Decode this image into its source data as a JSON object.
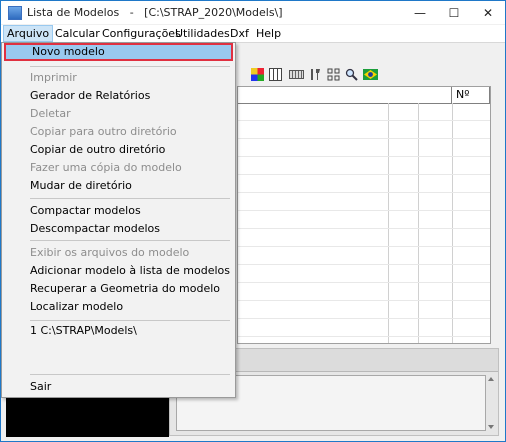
{
  "window": {
    "title": "Lista de Modelos   -   [C:\\STRAP_2020\\Models\\]",
    "minimize_glyph": "—",
    "maximize_glyph": "☐",
    "close_glyph": "✕"
  },
  "menubar": {
    "items": [
      {
        "label": "Arquivo"
      },
      {
        "label": "Calcular"
      },
      {
        "label": "Configurações"
      },
      {
        "label": "Utilidades"
      },
      {
        "label": "Dxf"
      },
      {
        "label": "Help"
      }
    ]
  },
  "arquivo_menu": {
    "items": [
      {
        "label": "Novo modelo",
        "enabled": true
      },
      {
        "label": "Imprimir",
        "enabled": false
      },
      {
        "label": "Gerador de Relatórios",
        "enabled": true
      },
      {
        "label": "Deletar",
        "enabled": false
      },
      {
        "label": "Copiar para outro diretório",
        "enabled": false
      },
      {
        "label": "Copiar de outro diretório",
        "enabled": true
      },
      {
        "label": "Fazer uma cópia do modelo",
        "enabled": false
      },
      {
        "label": "Mudar de diretório",
        "enabled": true
      },
      {
        "label": "Compactar modelos",
        "enabled": true
      },
      {
        "label": "Descompactar modelos",
        "enabled": true
      },
      {
        "label": "Exibir os arquivos do modelo",
        "enabled": false
      },
      {
        "label": "Adicionar modelo à lista de modelos",
        "enabled": true
      },
      {
        "label": "Recuperar a Geometria do modelo",
        "enabled": true
      },
      {
        "label": "Localizar modelo",
        "enabled": true
      },
      {
        "label": "1 C:\\STRAP\\Models\\",
        "enabled": true
      },
      {
        "label": "Sair",
        "enabled": true
      }
    ]
  },
  "table": {
    "number_column_header": "Nº"
  },
  "toolbar": {
    "icons": [
      "palette-icon",
      "grid-icon",
      "keyboard-icon",
      "tools-icon",
      "settings-grid-icon",
      "magnifier-icon",
      "brazil-flag-icon"
    ]
  },
  "colors": {
    "selection_bg": "#99c9ef",
    "selection_border": "#e03040",
    "window_border": "#1f78c8"
  }
}
